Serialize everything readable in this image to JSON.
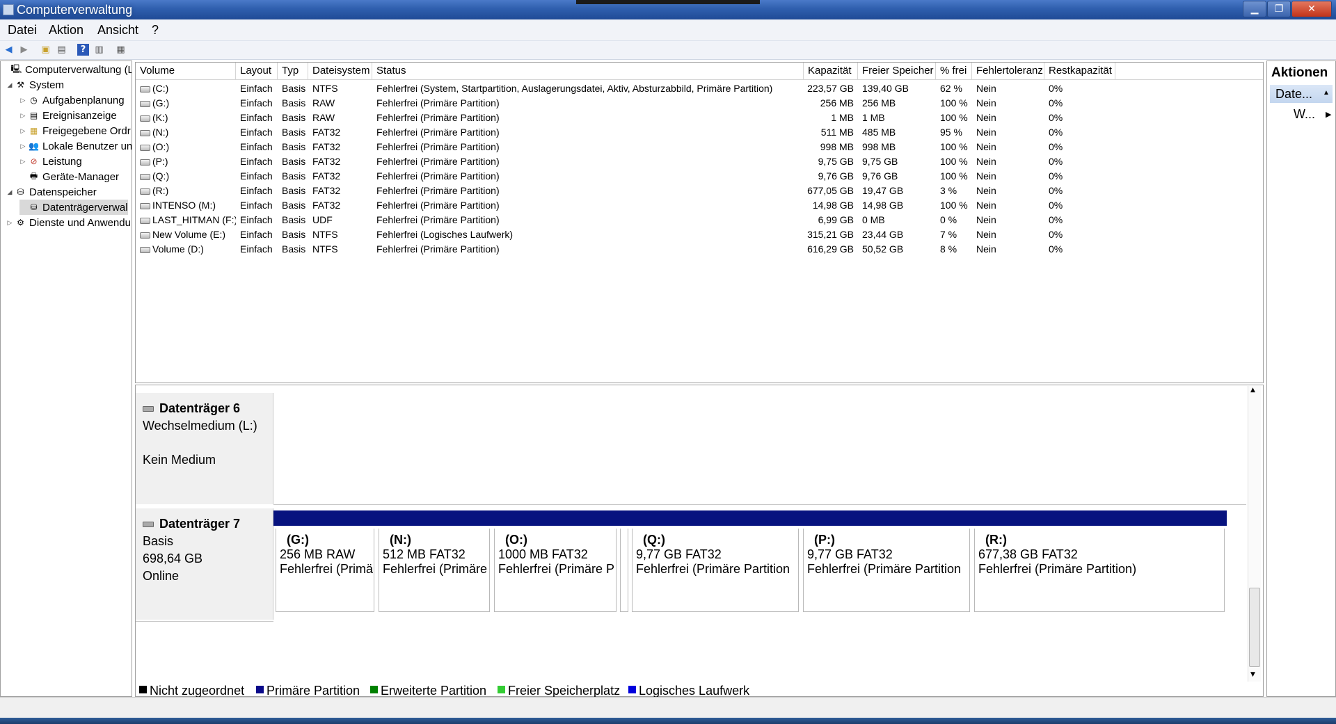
{
  "window": {
    "title": "Computerverwaltung"
  },
  "menu": [
    "Datei",
    "Aktion",
    "Ansicht",
    "?"
  ],
  "toolbar": [
    "back-arrow-icon",
    "forward-arrow-icon",
    "up-folder-icon",
    "show-tree-icon",
    "help-icon",
    "show-action-pane-icon",
    "properties-icon"
  ],
  "tree": [
    {
      "label": "Computerverwaltung (Lc",
      "icon": "computer-icon",
      "level": 0,
      "expander": ""
    },
    {
      "label": "System",
      "icon": "tools-icon",
      "level": 1,
      "expander": "◢"
    },
    {
      "label": "Aufgabenplanung",
      "icon": "clock-icon",
      "level": 2,
      "expander": "▷"
    },
    {
      "label": "Ereignisanzeige",
      "icon": "event-viewer-icon",
      "level": 2,
      "expander": "▷"
    },
    {
      "label": "Freigegebene Ordr",
      "icon": "shared-folder-icon",
      "level": 2,
      "expander": "▷"
    },
    {
      "label": "Lokale Benutzer un",
      "icon": "users-icon",
      "level": 2,
      "expander": "▷"
    },
    {
      "label": "Leistung",
      "icon": "performance-icon",
      "level": 2,
      "expander": "▷"
    },
    {
      "label": "Geräte-Manager",
      "icon": "device-manager-icon",
      "level": 2,
      "expander": ""
    },
    {
      "label": "Datenspeicher",
      "icon": "storage-icon",
      "level": 1,
      "expander": "◢"
    },
    {
      "label": "Datenträgerverwal",
      "icon": "disk-management-icon",
      "level": 2,
      "expander": "",
      "selected": true
    },
    {
      "label": "Dienste und Anwendu",
      "icon": "services-icon",
      "level": 1,
      "expander": "▷"
    }
  ],
  "table": {
    "columns": [
      "Volume",
      "Layout",
      "Typ",
      "Dateisystem",
      "Status",
      "Kapazität",
      "Freier Speicher",
      "% frei",
      "Fehlertoleranz",
      "Restkapazität"
    ],
    "rows": [
      [
        "(C:)",
        "Einfach",
        "Basis",
        "NTFS",
        "Fehlerfrei (System, Startpartition, Auslagerungsdatei, Aktiv, Absturzabbild, Primäre Partition)",
        "223,57 GB",
        "139,40 GB",
        "62 %",
        "Nein",
        "0%"
      ],
      [
        "(G:)",
        "Einfach",
        "Basis",
        "RAW",
        "Fehlerfrei (Primäre Partition)",
        "256 MB",
        "256 MB",
        "100 %",
        "Nein",
        "0%"
      ],
      [
        "(K:)",
        "Einfach",
        "Basis",
        "RAW",
        "Fehlerfrei (Primäre Partition)",
        "1 MB",
        "1 MB",
        "100 %",
        "Nein",
        "0%"
      ],
      [
        "(N:)",
        "Einfach",
        "Basis",
        "FAT32",
        "Fehlerfrei (Primäre Partition)",
        "511 MB",
        "485 MB",
        "95 %",
        "Nein",
        "0%"
      ],
      [
        "(O:)",
        "Einfach",
        "Basis",
        "FAT32",
        "Fehlerfrei (Primäre Partition)",
        "998 MB",
        "998 MB",
        "100 %",
        "Nein",
        "0%"
      ],
      [
        "(P:)",
        "Einfach",
        "Basis",
        "FAT32",
        "Fehlerfrei (Primäre Partition)",
        "9,75 GB",
        "9,75 GB",
        "100 %",
        "Nein",
        "0%"
      ],
      [
        "(Q:)",
        "Einfach",
        "Basis",
        "FAT32",
        "Fehlerfrei (Primäre Partition)",
        "9,76 GB",
        "9,76 GB",
        "100 %",
        "Nein",
        "0%"
      ],
      [
        "(R:)",
        "Einfach",
        "Basis",
        "FAT32",
        "Fehlerfrei (Primäre Partition)",
        "677,05 GB",
        "19,47 GB",
        "3 %",
        "Nein",
        "0%"
      ],
      [
        "INTENSO (M:)",
        "Einfach",
        "Basis",
        "FAT32",
        "Fehlerfrei (Primäre Partition)",
        "14,98 GB",
        "14,98 GB",
        "100 %",
        "Nein",
        "0%"
      ],
      [
        "LAST_HITMAN (F:)",
        "Einfach",
        "Basis",
        "UDF",
        "Fehlerfrei (Primäre Partition)",
        "6,99 GB",
        "0 MB",
        "0 %",
        "Nein",
        "0%"
      ],
      [
        "New Volume (E:)",
        "Einfach",
        "Basis",
        "NTFS",
        "Fehlerfrei (Logisches Laufwerk)",
        "315,21 GB",
        "23,44 GB",
        "7 %",
        "Nein",
        "0%"
      ],
      [
        "Volume (D:)",
        "Einfach",
        "Basis",
        "NTFS",
        "Fehlerfrei (Primäre Partition)",
        "616,29 GB",
        "50,52 GB",
        "8 %",
        "Nein",
        "0%"
      ]
    ]
  },
  "disks": [
    {
      "name": "Datenträger 6",
      "lines": [
        "Wechselmedium (L:)",
        "",
        "Kein Medium"
      ]
    },
    {
      "name": "Datenträger 7",
      "lines": [
        "Basis",
        "698,64 GB",
        "Online"
      ]
    }
  ],
  "partitions": [
    {
      "label": "(G:)",
      "size": "256 MB RAW",
      "status": "Fehlerfrei (Primä"
    },
    {
      "label": "(N:)",
      "size": "512 MB FAT32",
      "status": "Fehlerfrei (Primäre"
    },
    {
      "label": "(O:)",
      "size": "1000 MB FAT32",
      "status": "Fehlerfrei (Primäre P"
    },
    {
      "label": "",
      "size": "",
      "status": ""
    },
    {
      "label": "(Q:)",
      "size": "9,77 GB FAT32",
      "status": "Fehlerfrei (Primäre Partition"
    },
    {
      "label": "(P:)",
      "size": "9,77 GB FAT32",
      "status": "Fehlerfrei (Primäre Partition"
    },
    {
      "label": "(R:)",
      "size": "677,38 GB FAT32",
      "status": "Fehlerfrei (Primäre Partition)"
    }
  ],
  "legend": [
    {
      "label": "Nicht zugeordnet",
      "color": "#000000"
    },
    {
      "label": "Primäre Partition",
      "color": "#0a0a8a"
    },
    {
      "label": "Erweiterte Partition",
      "color": "#008000"
    },
    {
      "label": "Freier Speicherplatz",
      "color": "#33cc33"
    },
    {
      "label": "Logisches Laufwerk",
      "color": "#0000dd"
    }
  ],
  "actions": {
    "title": "Aktionen",
    "section": "Date...",
    "item": "W..."
  }
}
